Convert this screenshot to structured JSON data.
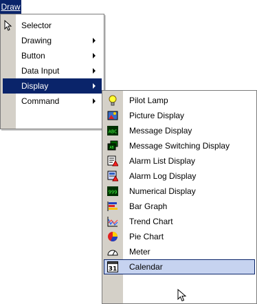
{
  "menubar": {
    "draw": "Draw"
  },
  "draw_menu": {
    "items": [
      {
        "label": "Selector",
        "icon": "arrow-pointer-icon",
        "submenu": false
      },
      {
        "label": "Drawing",
        "submenu": true
      },
      {
        "label": "Button",
        "submenu": true
      },
      {
        "label": "Data Input",
        "submenu": true
      },
      {
        "label": "Display",
        "submenu": true,
        "selected": true
      },
      {
        "label": "Command",
        "submenu": true
      }
    ]
  },
  "display_menu": {
    "items": [
      {
        "label": "Pilot Lamp",
        "icon": "pilot-lamp-icon"
      },
      {
        "label": "Picture Display",
        "icon": "picture-display-icon"
      },
      {
        "label": "Message Display",
        "icon": "message-display-icon",
        "icon_text": "ABC"
      },
      {
        "label": "Message Switching Display",
        "icon": "message-switching-icon",
        "icon_text": "AB"
      },
      {
        "label": "Alarm List Display",
        "icon": "alarm-list-icon"
      },
      {
        "label": "Alarm Log Display",
        "icon": "alarm-log-icon"
      },
      {
        "label": "Numerical Display",
        "icon": "numerical-display-icon",
        "icon_text": "999"
      },
      {
        "label": "Bar Graph",
        "icon": "bar-graph-icon"
      },
      {
        "label": "Trend Chart",
        "icon": "trend-chart-icon"
      },
      {
        "label": "Pie Chart",
        "icon": "pie-chart-icon"
      },
      {
        "label": "Meter",
        "icon": "meter-icon"
      },
      {
        "label": "Calendar",
        "icon": "calendar-icon",
        "icon_text": "31",
        "highlighted": true
      }
    ]
  },
  "colors": {
    "selection": "#0a246a",
    "hover_fill": "#c6d3f0",
    "gutter": "#d4d0c8"
  }
}
